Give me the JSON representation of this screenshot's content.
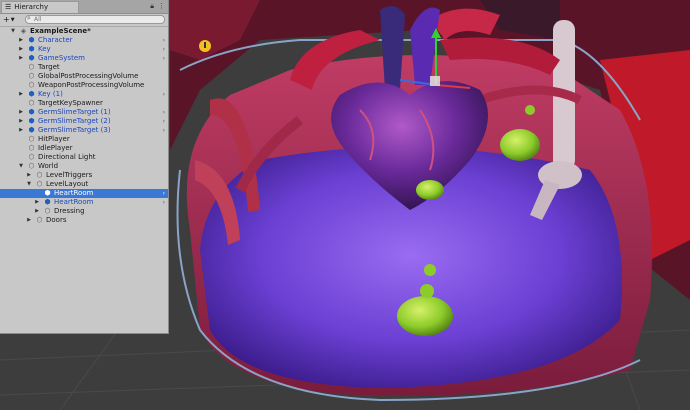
{
  "hierarchy": {
    "tab_title": "Hierarchy",
    "search_placeholder": "All",
    "add_label": "+",
    "items": [
      {
        "label": "ExampleScene*",
        "depth": 0,
        "type": "scene",
        "arrow": "expanded",
        "chevron": false
      },
      {
        "label": "Character",
        "depth": 1,
        "type": "prefab",
        "arrow": "collapsed",
        "chevron": true
      },
      {
        "label": "Key",
        "depth": 1,
        "type": "prefab",
        "arrow": "collapsed",
        "chevron": true
      },
      {
        "label": "GameSystem",
        "depth": 1,
        "type": "prefab",
        "arrow": "collapsed",
        "chevron": true
      },
      {
        "label": "Target",
        "depth": 1,
        "type": "object",
        "arrow": "none",
        "chevron": false
      },
      {
        "label": "GlobalPostProcessingVolume",
        "depth": 1,
        "type": "object",
        "arrow": "none",
        "chevron": false
      },
      {
        "label": "WeaponPostProcessingVolume",
        "depth": 1,
        "type": "object",
        "arrow": "none",
        "chevron": false
      },
      {
        "label": "Key (1)",
        "depth": 1,
        "type": "prefab",
        "arrow": "collapsed",
        "chevron": true
      },
      {
        "label": "TargetKeySpawner",
        "depth": 1,
        "type": "object",
        "arrow": "none",
        "chevron": false
      },
      {
        "label": "GermSlimeTarget (1)",
        "depth": 1,
        "type": "prefab",
        "arrow": "collapsed",
        "chevron": true
      },
      {
        "label": "GermSlimeTarget (2)",
        "depth": 1,
        "type": "prefab",
        "arrow": "collapsed",
        "chevron": true
      },
      {
        "label": "GermSlimeTarget (3)",
        "depth": 1,
        "type": "prefab",
        "arrow": "collapsed",
        "chevron": true
      },
      {
        "label": "HitPlayer",
        "depth": 1,
        "type": "object",
        "arrow": "none",
        "chevron": false
      },
      {
        "label": "IdlePlayer",
        "depth": 1,
        "type": "object",
        "arrow": "none",
        "chevron": false
      },
      {
        "label": "Directional Light",
        "depth": 1,
        "type": "object",
        "arrow": "none",
        "chevron": false
      },
      {
        "label": "World",
        "depth": 1,
        "type": "object",
        "arrow": "expanded",
        "chevron": false
      },
      {
        "label": "LevelTriggers",
        "depth": 2,
        "type": "object",
        "arrow": "collapsed",
        "chevron": false
      },
      {
        "label": "LevelLayout",
        "depth": 2,
        "type": "object",
        "arrow": "expanded",
        "chevron": false
      },
      {
        "label": "HeartRoom",
        "depth": 3,
        "type": "prefab",
        "arrow": "none",
        "chevron": true,
        "selected": true
      },
      {
        "label": "HeartRoom",
        "depth": 3,
        "type": "prefab",
        "arrow": "collapsed",
        "chevron": true
      },
      {
        "label": "Dressing",
        "depth": 3,
        "type": "object",
        "arrow": "collapsed",
        "chevron": false
      },
      {
        "label": "Doors",
        "depth": 2,
        "type": "object",
        "arrow": "collapsed",
        "chevron": false
      }
    ]
  },
  "colors": {
    "panel_bg": "#c8c8c8",
    "selection": "#3a78d6",
    "prefab_text": "#1b47b8",
    "floor": "#6b3fd0",
    "heart": "#6a2a8a",
    "vessels": "#b8203a",
    "slime": "#8fcf2a",
    "gizmo_y": "#2fd22f",
    "gizmo_x": "#e03a3a",
    "gizmo_z": "#3a6ae0"
  }
}
